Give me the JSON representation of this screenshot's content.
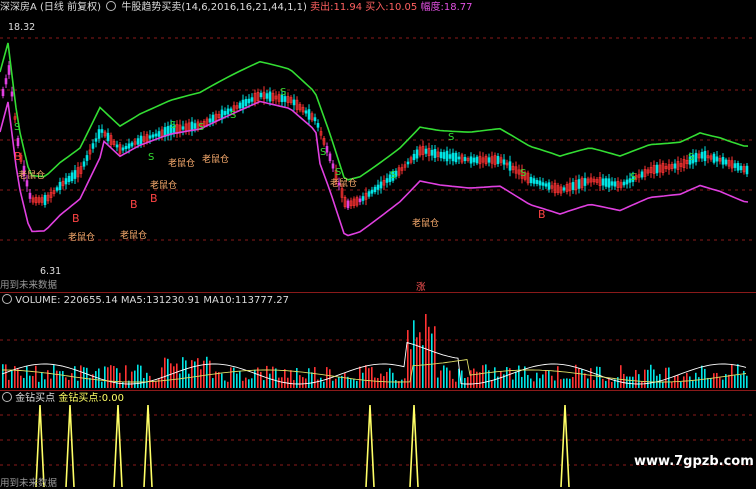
{
  "header": {
    "stock_name": "深深房A",
    "period": "(日线 前复权)",
    "indicator_icon": "circle-dot-icon",
    "indicator_name": "牛股趋势买卖",
    "indicator_params": "(14,6,2016,16,21,44,1,1)",
    "sell_label": "卖出:",
    "sell_value": "11.94",
    "buy_label": "买入:",
    "buy_value": "10.05",
    "range_label": "幅度:",
    "range_value": "18.77"
  },
  "price_panel": {
    "high_label": "18.32",
    "low_label": "6.31",
    "future_label": "用到未来数据",
    "zhang_label": "涨",
    "signal_b": "B",
    "signal_s": "S",
    "rat_label": "老鼠仓"
  },
  "volume_panel": {
    "title": "VOLUME:",
    "volume_value": "220655.14",
    "ma5_label": "MA5:",
    "ma5_value": "131230.91",
    "ma10_label": "MA10:",
    "ma10_value": "113777.27"
  },
  "signal_panel": {
    "title": "金钻买点",
    "value_label": "金钻买点:",
    "value": "0.00",
    "future_label": "用到未来数据"
  },
  "watermark": "www.7gpzb.com",
  "colors": {
    "up": "#ff3333",
    "down": "#00e5e5",
    "green_line": "#33dd33",
    "magenta_line": "#e040e0",
    "signal_yellow": "#ffff66",
    "grid_red": "#8a1a1a"
  },
  "chart_data": {
    "type": "candlestick",
    "ylim": [
      6.31,
      18.32
    ],
    "marked_high": 18.32,
    "marked_low": 6.31,
    "volume": 220655.14,
    "ma5": 131230.91,
    "ma10": 113777.27,
    "gold_buy_point": 0.0
  }
}
